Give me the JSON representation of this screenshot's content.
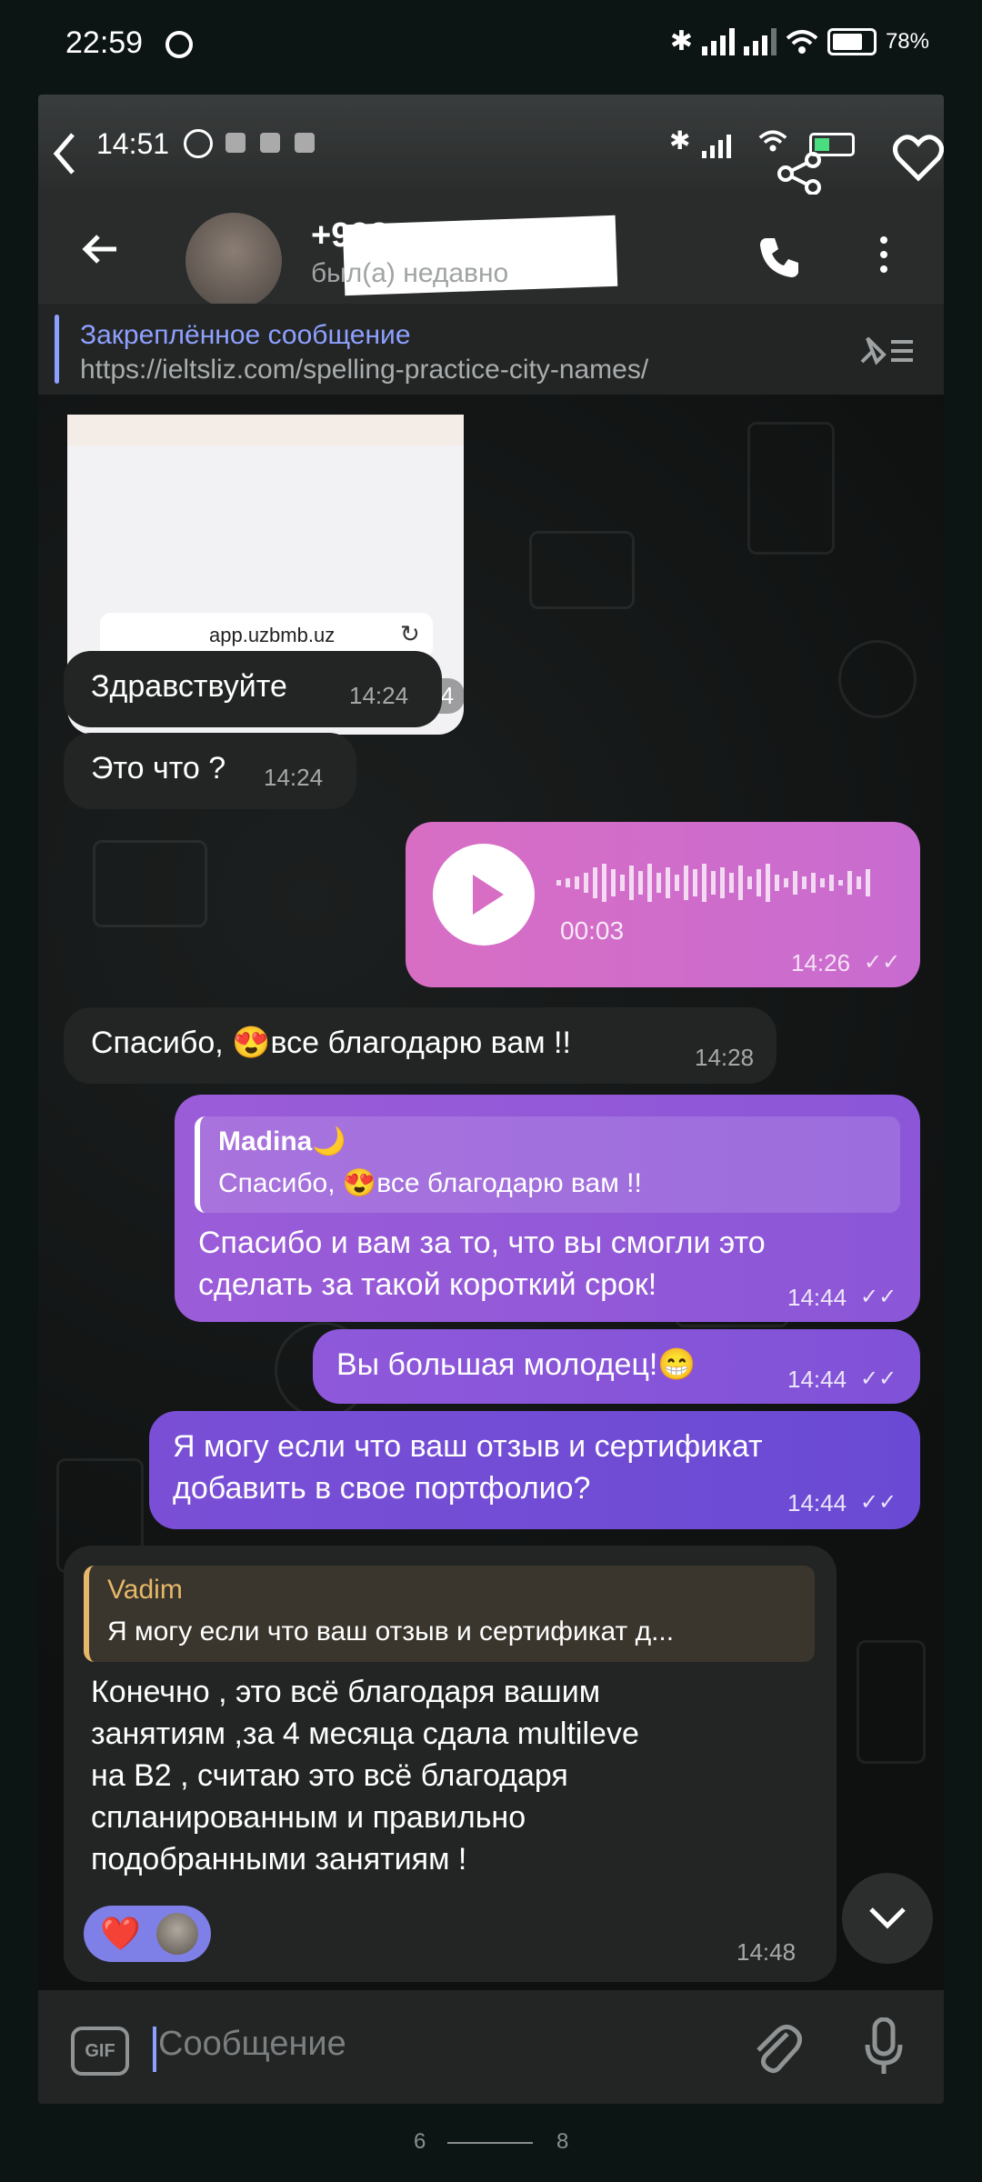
{
  "outer_status": {
    "time": "22:59",
    "battery": "78%"
  },
  "inner_status": {
    "time": "14:51"
  },
  "header": {
    "phone": "+998",
    "status": "был(а) недавно"
  },
  "pinned": {
    "title": "Закреплённое сообщение",
    "link": "https://ieltsliz.com/spelling-practice-city-names/"
  },
  "image_message": {
    "url": "app.uzbmb.uz",
    "time": "14:24"
  },
  "messages": {
    "hello": {
      "text": "Здравствуйте",
      "time": "14:24"
    },
    "what": {
      "text": "Это что ?",
      "time": "14:24"
    },
    "voice": {
      "duration": "00:03",
      "time": "14:26"
    },
    "thanks": {
      "text_before": "Спасибо, ",
      "emoji": "😍",
      "text_after": "все благодарю вам !!",
      "time": "14:28"
    },
    "reply1": {
      "quote_author": "Madina🌙",
      "quote_before": "Спасибо, ",
      "quote_emoji": "😍",
      "quote_after": "все благодарю вам !!",
      "text_line1": "Спасибо и вам за то, что вы смогли это",
      "text_line2": "сделать за такой короткий срок!",
      "time": "14:44"
    },
    "great": {
      "text": "Вы большая молодец!",
      "emoji": "😁",
      "time": "14:44"
    },
    "portfolio": {
      "text_line1": "Я могу если что ваш отзыв и сертификат",
      "text_line2": "добавить в свое портфолио?",
      "time": "14:44"
    },
    "answer": {
      "quote_author": "Vadim",
      "quote_text": "Я могу если что ваш отзыв и сертификат д...",
      "line1": "Конечно , это всё благодаря вашим",
      "line2": "занятиям ,за 4 месяца сдала multileve",
      "line3": "на B2 , считаю это всё благодаря",
      "line4": "спланированным и правильно",
      "line5": "подобранными занятиям !",
      "reaction": "❤️",
      "time": "14:48"
    }
  },
  "input": {
    "placeholder": "Сообщение",
    "gif_label": "GIF"
  },
  "pager": {
    "left": "6",
    "right": "8"
  },
  "colors": {
    "pink_bubble": "#d86ec4",
    "purple_bubble": "#7a4fd6",
    "in_bubble": "#232525",
    "quote_purple": "#8ea0ff",
    "quote_gold": "#e6b86a"
  }
}
